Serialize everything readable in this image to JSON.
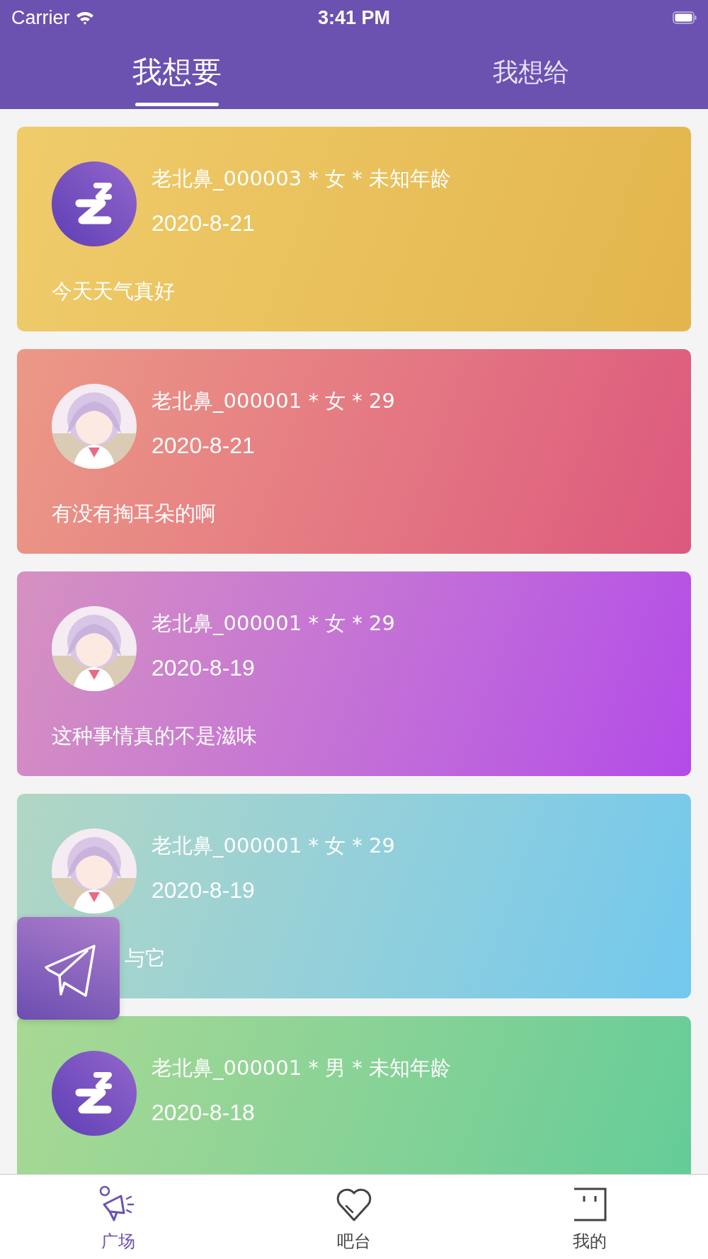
{
  "status_bar": {
    "carrier": "Carrier",
    "time": "3:41 PM"
  },
  "tabs": [
    {
      "label": "我想要",
      "selected": true
    },
    {
      "label": "我想给",
      "selected": false
    }
  ],
  "cards": [
    {
      "avatar": {
        "kind": "logo"
      },
      "author": "老北鼻_000003 * 女 * 未知年龄",
      "date": "2020-8-21",
      "text": "今天天气真好",
      "color": "#e3b54c"
    },
    {
      "author": "老北鼻_000001 * 女 * 29",
      "date": "2020-8-21",
      "text": "有没有掏耳朵的啊",
      "color": "#dc587e"
    },
    {
      "author": "老北鼻_000001 * 女 * 29",
      "date": "2020-8-19",
      "text": "这种事情真的不是滋味",
      "color": "#b44ae8"
    },
    {
      "author": "老北鼻_000001 * 女 * 29",
      "date": "2020-8-19",
      "text": "与它",
      "color": "#72c8ee"
    },
    {
      "avatar": {
        "kind": "logo"
      },
      "author": "老北鼻_000001 * 男 * 未知年龄",
      "date": "2020-8-18",
      "color": "#62cc98"
    }
  ],
  "bottom_tabs": [
    {
      "label": "广场",
      "kind": "square",
      "selected": true
    },
    {
      "label": "吧台",
      "kind": "heart",
      "selected": false
    },
    {
      "label": "我的",
      "kind": "face",
      "selected": false
    }
  ]
}
